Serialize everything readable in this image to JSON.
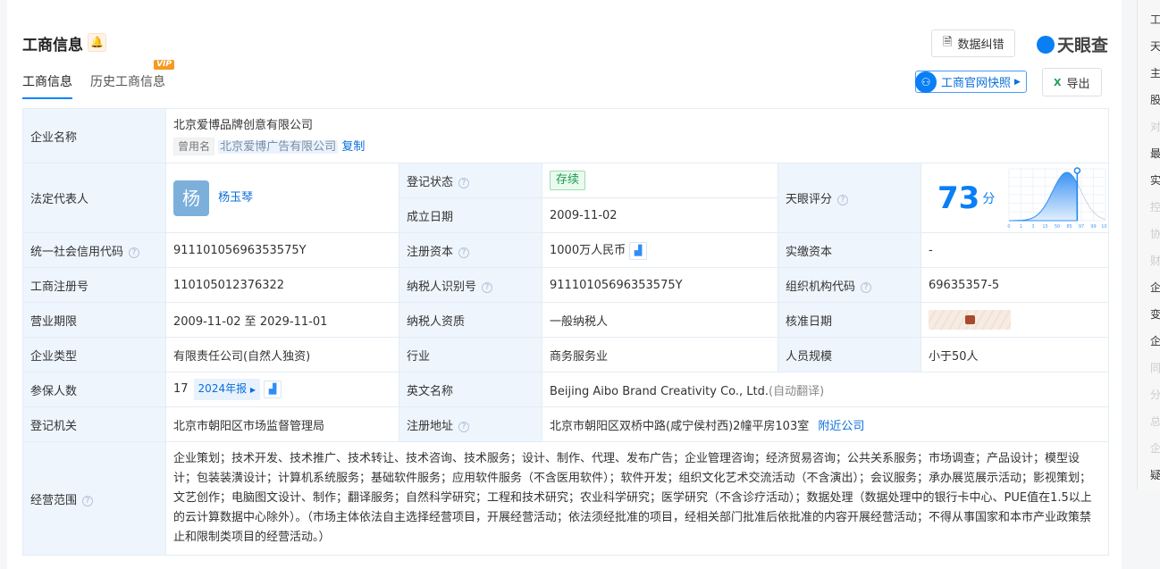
{
  "header": {
    "title": "工商信息",
    "correct_btn": "数据纠错",
    "logo": "天眼查",
    "snapshot_btn": "工商官网快照",
    "export_btn": "导出"
  },
  "tabs": [
    {
      "label": "工商信息",
      "active": true
    },
    {
      "label": "历史工商信息",
      "badge": "VIP"
    }
  ],
  "company": {
    "name_label": "企业名称",
    "name": "北京爱博品牌创意有限公司",
    "former_tag": "曾用名",
    "former_name": "北京爱博广告有限公司",
    "copy": "复制"
  },
  "legal": {
    "label": "法定代表人",
    "avatar": "杨",
    "name": "杨玉琴"
  },
  "status": {
    "label": "登记状态",
    "value": "存续"
  },
  "founded": {
    "label": "成立日期",
    "value": "2009-11-02"
  },
  "tianyan": {
    "label": "天眼评分",
    "score": "73",
    "unit": "分"
  },
  "credit_code": {
    "label": "统一社会信用代码",
    "value": "91110105696353575Y"
  },
  "reg_capital": {
    "label": "注册资本",
    "value": "1000万人民币"
  },
  "paid_capital": {
    "label": "实缴资本",
    "value": "-"
  },
  "reg_no": {
    "label": "工商注册号",
    "value": "110105012376322"
  },
  "tax_id": {
    "label": "纳税人识别号",
    "value": "91110105696353575Y"
  },
  "org_code": {
    "label": "组织机构代码",
    "value": "69635357-5"
  },
  "term": {
    "label": "营业期限",
    "value": "2009-11-02 至 2029-11-01"
  },
  "tax_qual": {
    "label": "纳税人资质",
    "value": "一般纳税人"
  },
  "approve": {
    "label": "核准日期"
  },
  "type": {
    "label": "企业类型",
    "value": "有限责任公司(自然人独资)"
  },
  "industry": {
    "label": "行业",
    "value": "商务服务业"
  },
  "staff": {
    "label": "人员规模",
    "value": "小于50人"
  },
  "insured": {
    "label": "参保人数",
    "value": "17",
    "report": "2024年报"
  },
  "en_name": {
    "label": "英文名称",
    "value": "Beijing Aibo Brand Creativity Co., Ltd.",
    "note": "(自动翻译)"
  },
  "authority": {
    "label": "登记机关",
    "value": "北京市朝阳区市场监督管理局"
  },
  "address": {
    "label": "注册地址",
    "value": "北京市朝阳区双桥中路(咸宁侯村西)2幢平房103室",
    "nearby": "附近公司"
  },
  "scope": {
    "label": "经营范围",
    "value": "企业策划；技术开发、技术推广、技术转让、技术咨询、技术服务；设计、制作、代理、发布广告；企业管理咨询；经济贸易咨询；公共关系服务；市场调查；产品设计；模型设计；包装装潢设计；计算机系统服务；基础软件服务；应用软件服务（不含医用软件）；软件开发；组织文化艺术交流活动（不含演出）；会议服务；承办展览展示活动；影视策划；文艺创作；电脑图文设计、制作；翻译服务；自然科学研究；工程和技术研究；农业科学研究；医学研究（不含诊疗活动）；数据处理（数据处理中的银行卡中心、PUE值在1.5以上的云计算数据中心除外）。（市场主体依法自主选择经营项目，开展经营活动；依法须经批准的项目，经相关部门批准后依批准的内容开展经营活动；不得从事国家和本市产业政策禁止和限制类项目的经营活动。）"
  },
  "side_nav": [
    {
      "t": "工",
      "dim": false
    },
    {
      "t": "天",
      "dim": false
    },
    {
      "t": "主",
      "dim": false
    },
    {
      "t": "股",
      "dim": false
    },
    {
      "t": "对",
      "dim": true
    },
    {
      "t": "最",
      "dim": false
    },
    {
      "t": "实",
      "dim": false
    },
    {
      "t": "控",
      "dim": true
    },
    {
      "t": "协",
      "dim": true
    },
    {
      "t": "财",
      "dim": true
    },
    {
      "t": "企",
      "dim": false
    },
    {
      "t": "变",
      "dim": false
    },
    {
      "t": "企",
      "dim": false
    },
    {
      "t": "同",
      "dim": true
    },
    {
      "t": "分",
      "dim": true
    },
    {
      "t": "总",
      "dim": true
    },
    {
      "t": "企",
      "dim": true
    },
    {
      "t": "疑",
      "dim": false
    }
  ],
  "chart_data": {
    "type": "area",
    "title": "天眼评分分布",
    "x_ticks": [
      "0",
      "1",
      "3",
      "15",
      "50",
      "85",
      "97",
      "99",
      "100"
    ],
    "marker_value": 73,
    "accent": "#0a7ff5"
  }
}
